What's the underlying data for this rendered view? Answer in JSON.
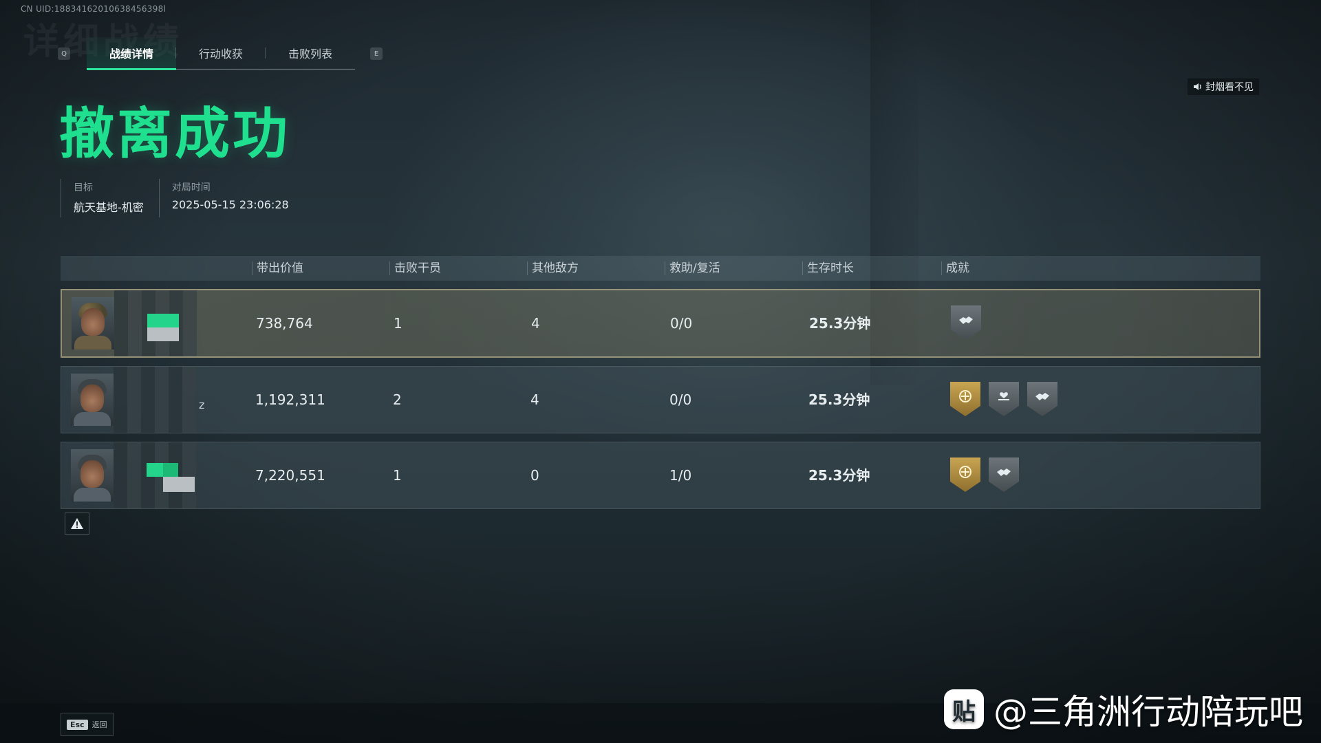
{
  "uid_text": "CN UID:18834162010638456398l",
  "header": {
    "ghost_title": "详细战绩",
    "left_key": "Q",
    "right_key": "E",
    "tabs": [
      {
        "label": "战绩详情",
        "active": true
      },
      {
        "label": "行动收获",
        "active": false
      },
      {
        "label": "击败列表",
        "active": false
      }
    ]
  },
  "sound_button": {
    "label": "封烟看不见",
    "icon": "speaker-icon"
  },
  "result": {
    "title": "撤离成功",
    "color": "#1fe08f"
  },
  "meta": {
    "target_label": "目标",
    "target_value": "航天基地-机密",
    "time_label": "对局时间",
    "time_value": "2025-05-15 23:06:28"
  },
  "table": {
    "headers": [
      "带出价值",
      "击败干员",
      "其他敌方",
      "救助/复活",
      "生存时长",
      "成就"
    ],
    "rows": [
      {
        "value": "738,764",
        "kills_op": "1",
        "kills_other": "4",
        "assist": "0/0",
        "survive": "25.3分钟",
        "badges": [
          "silver"
        ],
        "self": true
      },
      {
        "value": "1,192,311",
        "kills_op": "2",
        "kills_other": "4",
        "assist": "0/0",
        "survive": "25.3分钟",
        "badges": [
          "gold",
          "silver",
          "silver"
        ],
        "name_fragment": "z"
      },
      {
        "value": "7,220,551",
        "kills_op": "1",
        "kills_other": "0",
        "assist": "1/0",
        "survive": "25.3分钟",
        "badges": [
          "gold",
          "silver"
        ]
      }
    ]
  },
  "report_icon": "warning-icon",
  "footer": {
    "esc_key": "Esc",
    "esc_label": "返回"
  },
  "watermark": {
    "logo_text": "贴",
    "text": "@三角洲行动陪玩吧"
  }
}
